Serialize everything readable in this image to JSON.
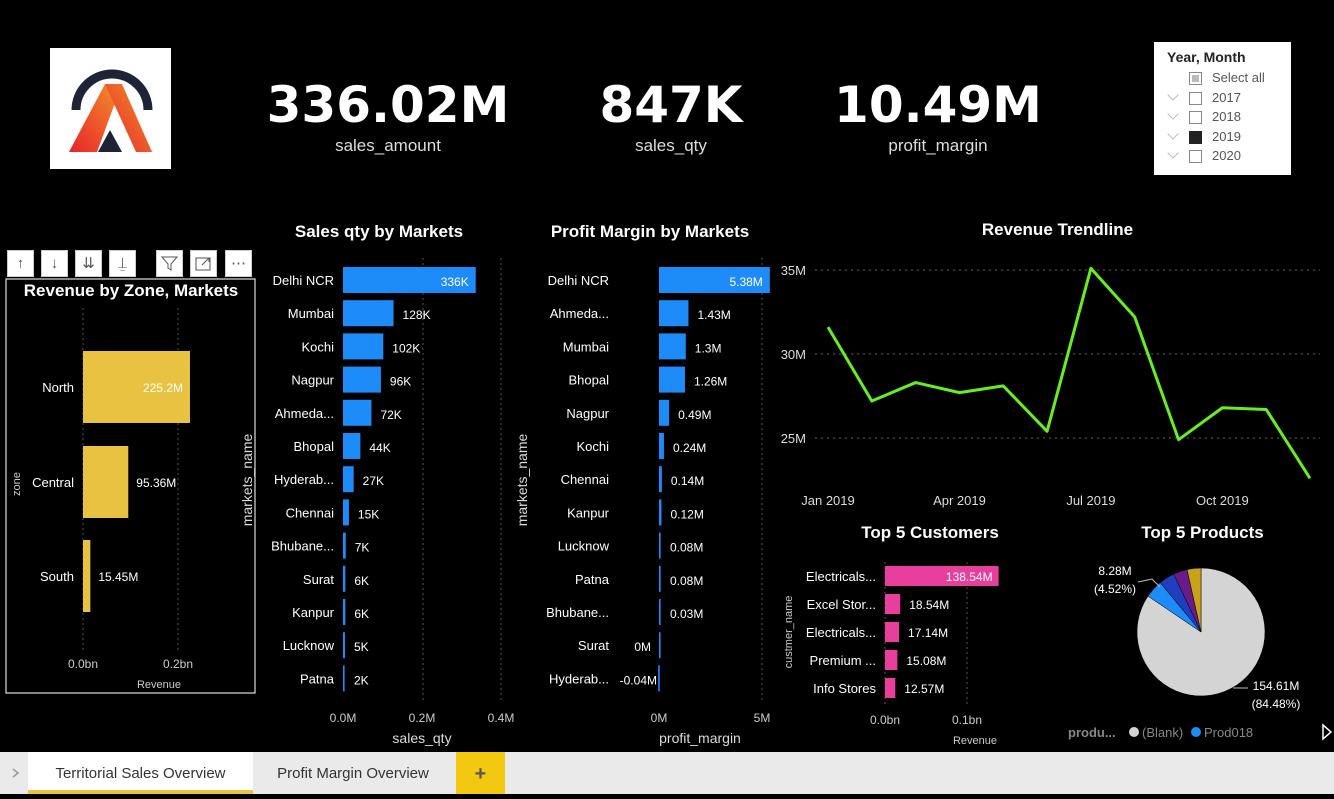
{
  "kpis": [
    {
      "value": "336.02M",
      "label": "sales_amount"
    },
    {
      "value": "847K",
      "label": "sales_qty"
    },
    {
      "value": "10.49M",
      "label": "profit_margin"
    }
  ],
  "slicer": {
    "title": "Year, Month",
    "items": [
      {
        "label": "Select all",
        "state": "partial"
      },
      {
        "label": "2017",
        "state": "off"
      },
      {
        "label": "2018",
        "state": "off"
      },
      {
        "label": "2019",
        "state": "on"
      },
      {
        "label": "2020",
        "state": "off"
      }
    ]
  },
  "toolbar": {
    "icons": [
      "arrow-up-icon",
      "arrow-down-icon",
      "double-arrow-down-icon",
      "expand-hierarchy-icon",
      "filter-icon",
      "focus-mode-icon",
      "more-options-icon"
    ]
  },
  "tabs": {
    "tab1": "Territorial Sales Overview",
    "tab2": "Profit Margin Overview",
    "add": "+"
  },
  "chart_data": [
    {
      "id": "zone",
      "type": "bar",
      "title": "Revenue by Zone, Markets",
      "xlabel": "Revenue",
      "ylabel": "zone",
      "categories": [
        "North",
        "Central",
        "South"
      ],
      "values": [
        225.2,
        95.36,
        15.45
      ],
      "value_labels": [
        "225.2M",
        "95.36M",
        "15.45M"
      ],
      "xlim": [
        0,
        0.25
      ],
      "ticks": [
        "0.0bn",
        "0.2bn"
      ],
      "tick_values": [
        0,
        0.2
      ],
      "unit": "bn",
      "color": "#e8c240"
    },
    {
      "id": "qty",
      "type": "bar",
      "title": "Sales qty by Markets",
      "xlabel": "sales_qty",
      "ylabel": "markets_name",
      "categories": [
        "Delhi NCR",
        "Mumbai",
        "Kochi",
        "Nagpur",
        "Ahmeda...",
        "Bhopal",
        "Hyderab...",
        "Chennai",
        "Bhubane...",
        "Surat",
        "Kanpur",
        "Lucknow",
        "Patna"
      ],
      "values": [
        336,
        128,
        102,
        96,
        72,
        44,
        27,
        15,
        7,
        6,
        6,
        5,
        2
      ],
      "value_labels": [
        "336K",
        "128K",
        "102K",
        "96K",
        "72K",
        "44K",
        "27K",
        "15K",
        "7K",
        "6K",
        "6K",
        "5K",
        "2K"
      ],
      "xlim": [
        0,
        400
      ],
      "ticks": [
        "0.0M",
        "0.2M",
        "0.4M"
      ],
      "tick_values": [
        0,
        200,
        400
      ],
      "color": "#1d8cf8"
    },
    {
      "id": "pm",
      "type": "bar",
      "title": "Profit Margin by Markets",
      "xlabel": "profit_margin",
      "ylabel": "markets_name",
      "categories": [
        "Delhi NCR",
        "Ahmeda...",
        "Mumbai",
        "Bhopal",
        "Nagpur",
        "Kochi",
        "Chennai",
        "Kanpur",
        "Lucknow",
        "Patna",
        "Bhubane...",
        "Surat",
        "Hyderab..."
      ],
      "values": [
        5.38,
        1.43,
        1.3,
        1.26,
        0.49,
        0.24,
        0.14,
        0.12,
        0.08,
        0.08,
        0.03,
        0,
        -0.04
      ],
      "value_labels": [
        "5.38M",
        "1.43M",
        "1.3M",
        "1.26M",
        "0.49M",
        "0.24M",
        "0.14M",
        "0.12M",
        "0.08M",
        "0.08M",
        "0.03M",
        "0M",
        "-0.04M"
      ],
      "xlim": [
        0,
        5
      ],
      "ticks": [
        "0M",
        "5M"
      ],
      "tick_values": [
        0,
        5
      ],
      "color": "#1d8cf8"
    },
    {
      "id": "trend",
      "type": "line",
      "title": "Revenue Trendline",
      "x": [
        "2019-01",
        "2019-02",
        "2019-03",
        "2019-04",
        "2019-05",
        "2019-06",
        "2019-07",
        "2019-08",
        "2019-09",
        "2019-10",
        "2019-11",
        "2019-12"
      ],
      "values": [
        31.6,
        27.2,
        28.3,
        27.7,
        28.1,
        25.4,
        35.1,
        32.2,
        24.9,
        26.8,
        26.7,
        22.6
      ],
      "ylim": [
        22,
        36
      ],
      "yticks": [
        "25M",
        "30M",
        "35M"
      ],
      "ytick_values": [
        25,
        30,
        35
      ],
      "xticks": [
        "Jan 2019",
        "Apr 2019",
        "Jul 2019",
        "Oct 2019"
      ],
      "xtick_index": [
        0,
        3,
        6,
        9
      ],
      "color": "#66ee22"
    },
    {
      "id": "cust",
      "type": "bar",
      "title": "Top 5 Customers",
      "xlabel": "Revenue",
      "ylabel": "custmer_name",
      "categories": [
        "Electricals...",
        "Excel Stor...",
        "Electricals...",
        "Premium ...",
        "Info Stores"
      ],
      "values": [
        138.54,
        18.54,
        17.14,
        15.08,
        12.57
      ],
      "value_labels": [
        "138.54M",
        "18.54M",
        "17.14M",
        "15.08M",
        "12.57M"
      ],
      "xlim": [
        0,
        0.15
      ],
      "ticks": [
        "0.0bn",
        "0.1bn"
      ],
      "tick_values": [
        0,
        0.1
      ],
      "unit": "bn",
      "color": "#e83e9c"
    },
    {
      "id": "prod",
      "type": "pie",
      "title": "Top 5 Products",
      "slices": [
        {
          "label": "(Blank)",
          "value": 84.48,
          "color": "#d4d4d4"
        },
        {
          "label": "Prod018",
          "value": 4.52,
          "color": "#1d8cf8"
        },
        {
          "label": "",
          "value": 4.0,
          "color": "#1f3fbf"
        },
        {
          "label": "",
          "value": 3.5,
          "color": "#6a1b8a"
        },
        {
          "label": "",
          "value": 3.5,
          "color": "#c9a21a"
        }
      ],
      "annotations": {
        "small": "8.28M",
        "small_pct": "(4.52%)",
        "big": "154.61M",
        "big_pct": "(84.48%)"
      },
      "legend": {
        "title": "produ...",
        "items": [
          "(Blank)",
          "Prod018"
        ]
      }
    }
  ]
}
